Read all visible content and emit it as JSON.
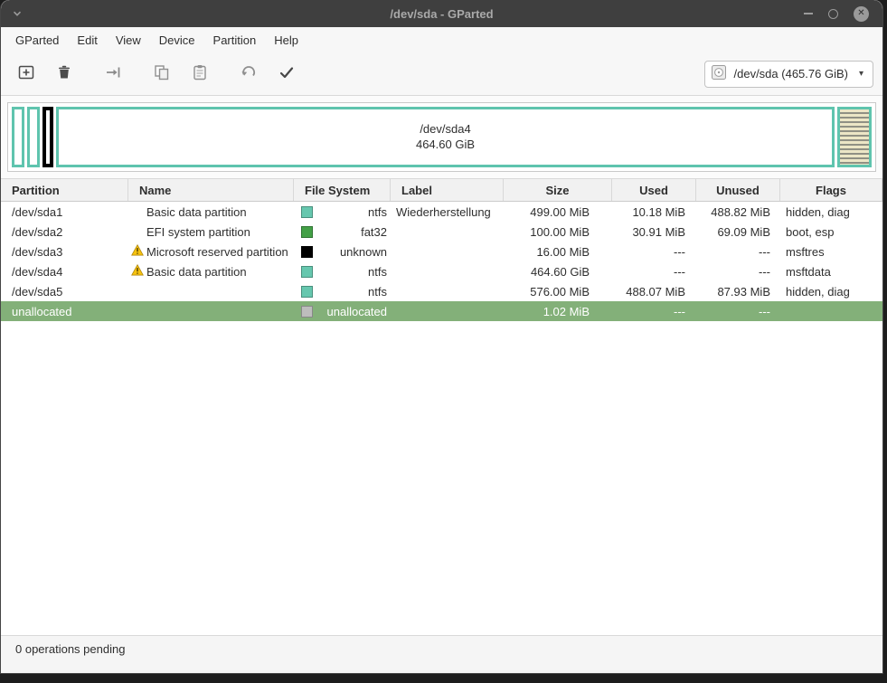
{
  "window": {
    "title": "/dev/sda - GParted"
  },
  "icons": {
    "window_menu": "chevron-down",
    "minimize": "dash",
    "restore": "circle-outline",
    "close": "✕",
    "dropdown": "▾",
    "new_partition": "plus-square",
    "delete_partition": "trash",
    "resize_move": "arrow-to-bar",
    "copy": "two-rectangles",
    "paste": "clipboard",
    "undo": "undo-arrow",
    "apply": "checkmark",
    "device": "disk-drive",
    "warning": "warning-triangle"
  },
  "menubar": {
    "items": [
      "GParted",
      "Edit",
      "View",
      "Device",
      "Partition",
      "Help"
    ]
  },
  "toolbar": {
    "device_selector": {
      "label": "/dev/sda (465.76 GiB)"
    }
  },
  "disk_visual": {
    "segments": [
      {
        "id": "/dev/sda1",
        "border": "#5fc4ae",
        "width": 14,
        "fill": "plain",
        "label": "",
        "sublabel": ""
      },
      {
        "id": "/dev/sda2",
        "border": "#5fc4ae",
        "width": 14,
        "fill": "plain",
        "label": "",
        "sublabel": ""
      },
      {
        "id": "/dev/sda3",
        "border": "#000000",
        "width": 12,
        "fill": "plain",
        "label": "",
        "sublabel": ""
      },
      {
        "id": "/dev/sda4",
        "border": "#5fc4ae",
        "width": "flex",
        "fill": "plain",
        "label": "/dev/sda4",
        "sublabel": "464.60 GiB"
      },
      {
        "id": "/dev/sda5",
        "border": "#5fc4ae",
        "width": 38,
        "fill": "hatch",
        "label": "",
        "sublabel": ""
      }
    ]
  },
  "table": {
    "columns": [
      "Partition",
      "Name",
      "File System",
      "Label",
      "Size",
      "Used",
      "Unused",
      "Flags"
    ],
    "rows": [
      {
        "partition": "/dev/sda1",
        "warning": false,
        "name": "Basic data partition",
        "fs": "ntfs",
        "fs_key": "ntfs",
        "label": "Wiederherstellung",
        "size": "499.00 MiB",
        "used": "10.18 MiB",
        "unused": "488.82 MiB",
        "flags": "hidden, diag",
        "selected": false
      },
      {
        "partition": "/dev/sda2",
        "warning": false,
        "name": "EFI system partition",
        "fs": "fat32",
        "fs_key": "fat32",
        "label": "",
        "size": "100.00 MiB",
        "used": "30.91 MiB",
        "unused": "69.09 MiB",
        "flags": "boot, esp",
        "selected": false
      },
      {
        "partition": "/dev/sda3",
        "warning": true,
        "name": "Microsoft reserved partition",
        "fs": "unknown",
        "fs_key": "unknown",
        "label": "",
        "size": "16.00 MiB",
        "used": "---",
        "unused": "---",
        "flags": "msftres",
        "selected": false
      },
      {
        "partition": "/dev/sda4",
        "warning": true,
        "name": "Basic data partition",
        "fs": "ntfs",
        "fs_key": "ntfs",
        "label": "",
        "size": "464.60 GiB",
        "used": "---",
        "unused": "---",
        "flags": "msftdata",
        "selected": false
      },
      {
        "partition": "/dev/sda5",
        "warning": false,
        "name": "",
        "fs": "ntfs",
        "fs_key": "ntfs",
        "label": "",
        "size": "576.00 MiB",
        "used": "488.07 MiB",
        "unused": "87.93 MiB",
        "flags": "hidden, diag",
        "selected": false
      },
      {
        "partition": "unallocated",
        "warning": false,
        "name": "",
        "fs": "unallocated",
        "fs_key": "unallocated",
        "label": "",
        "size": "1.02 MiB",
        "used": "---",
        "unused": "---",
        "flags": "",
        "selected": true
      }
    ]
  },
  "statusbar": {
    "text": "0 operations pending"
  },
  "colors": {
    "fs_ntfs": "#66c7ae",
    "fs_fat32": "#43a047",
    "fs_unknown": "#000000",
    "fs_unallocated": "#bdbdbd",
    "selection": "#83b079",
    "partition_border": "#5fc4ae"
  }
}
